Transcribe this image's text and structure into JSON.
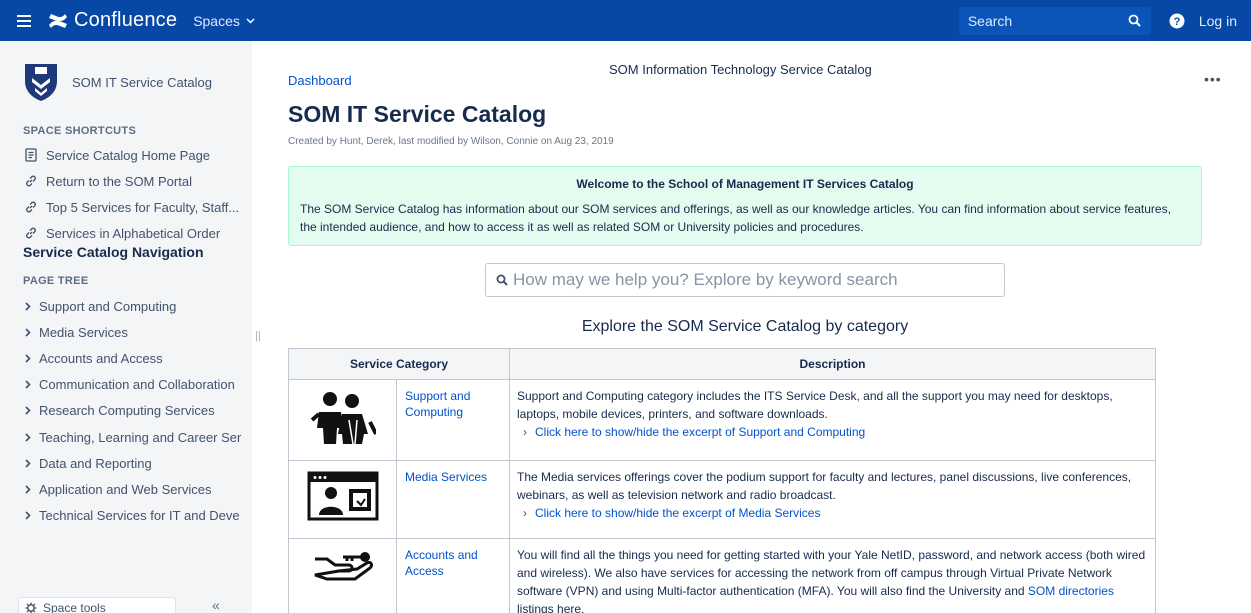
{
  "topbar": {
    "app_name": "Confluence",
    "spaces_label": "Spaces",
    "search_placeholder": "Search",
    "login_label": "Log in"
  },
  "sidebar": {
    "space_name": "SOM IT Service Catalog",
    "shortcuts_label": "SPACE SHORTCUTS",
    "shortcuts": [
      {
        "label": "Service Catalog Home Page",
        "icon": "page-icon"
      },
      {
        "label": "Return to the SOM Portal",
        "icon": "link-icon"
      },
      {
        "label": "Top 5 Services for Faculty, Staff...",
        "icon": "link-icon"
      },
      {
        "label": "Services in Alphabetical Order",
        "icon": "link-icon"
      }
    ],
    "nav_title": "Service Catalog Navigation",
    "page_tree_label": "PAGE TREE",
    "tree": [
      {
        "label": "Support and Computing"
      },
      {
        "label": "Media Services"
      },
      {
        "label": "Accounts and Access"
      },
      {
        "label": "Communication and Collaboration"
      },
      {
        "label": "Research Computing Services"
      },
      {
        "label": "Teaching, Learning and Career Ser"
      },
      {
        "label": "Data and Reporting"
      },
      {
        "label": "Application and Web Services"
      },
      {
        "label": "Technical Services for IT and Deve"
      }
    ],
    "space_tools_label": "Space tools"
  },
  "main": {
    "breadcrumb": "Dashboard",
    "header_title": "SOM Information Technology Service Catalog",
    "page_title": "SOM IT Service Catalog",
    "byline": "Created by Hunt, Derek, last modified by Wilson, Connie on Aug 23, 2019",
    "welcome": {
      "title": "Welcome to the School of Management IT Services Catalog",
      "text": "The SOM Service Catalog has information about our SOM services and offerings, as well as our knowledge articles.  You can find information about service features, the intended audience, and how to access it as well as related SOM or University policies and procedures."
    },
    "search_placeholder": "How may we help you?  Explore by keyword search",
    "explore_heading": "Explore the SOM Service Catalog by category",
    "table": {
      "headers": [
        "Service Category",
        "Description"
      ],
      "rows": [
        {
          "name": "Support and Computing",
          "description": "Support and Computing category includes the ITS Service Desk, and all the support you may need for desktops, laptops, mobile devices, printers, and software downloads.",
          "excerpt": "Click here to show/hide the excerpt of Support and Computing"
        },
        {
          "name": "Media Services",
          "description": "The Media services offerings cover the podium support for faculty and lectures, panel discussions, live conferences, webinars, as well as television network and radio broadcast.",
          "excerpt": "Click here to show/hide the excerpt of Media Services"
        },
        {
          "name": "Accounts and Access",
          "description_pre": "You will find all the things you need for getting started with your Yale NetID, password, and network access (both wired and wireless). We also have services for accessing the network from off campus through Virtual Private Network software (VPN) and using Multi-factor authentication (MFA). You will also find the University and ",
          "description_link": "SOM directories",
          "description_post": " listings here."
        }
      ]
    }
  },
  "colors": {
    "topbar": "#0747a6",
    "sidebar": "#f4f5f7",
    "link": "#0052cc",
    "welcome_bg": "#e3fcef",
    "welcome_border": "#abf5d1"
  }
}
